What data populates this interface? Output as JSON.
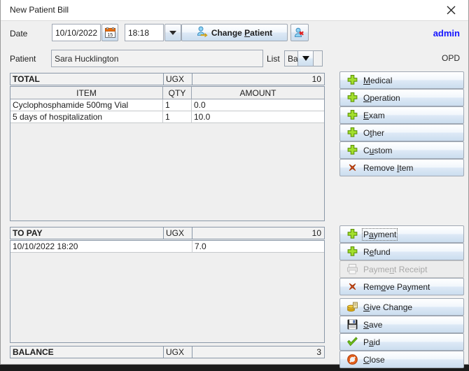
{
  "window": {
    "title": "New Patient Bill",
    "close_icon": "close-icon"
  },
  "header": {
    "date_label": "Date",
    "date_value": "10/10/2022",
    "calendar_icon": "calendar-icon",
    "time_value": "18:18",
    "time_spinner_icon": "chevron-down-icon",
    "change_patient_label_pre": "Change ",
    "change_patient_mnemonic": "P",
    "change_patient_label_post": "atient",
    "change_patient_icon": "user-switch-icon",
    "remove_patient_icon": "user-remove-icon",
    "user": "admin",
    "patient_label": "Patient",
    "patient_value": "Sara Hucklington",
    "list_label": "List",
    "list_value": "Basic",
    "list_arrow_icon": "chevron-down-icon",
    "department": "OPD"
  },
  "items": {
    "total": {
      "label": "TOTAL",
      "currency": "UGX",
      "value": "10"
    },
    "columns": {
      "item": "ITEM",
      "qty": "QTY",
      "amount": "AMOUNT"
    },
    "rows": [
      {
        "item": "Cyclophosphamide 500mg Vial",
        "qty": "1",
        "amount": "0.0"
      },
      {
        "item": "5 days of hospitalization",
        "qty": "1",
        "amount": "10.0"
      }
    ]
  },
  "payments": {
    "to_pay": {
      "label": "TO PAY",
      "currency": "UGX",
      "value": "10"
    },
    "rows": [
      {
        "date": "10/10/2022 18:20",
        "amount": "7.0"
      }
    ],
    "balance": {
      "label": "BALANCE",
      "currency": "UGX",
      "value": "3"
    }
  },
  "item_buttons": [
    {
      "name": "medical",
      "icon": "plus-green-icon",
      "pre": "",
      "mn": "M",
      "post": "edical",
      "disabled": false,
      "focused": false
    },
    {
      "name": "operation",
      "icon": "plus-green-icon",
      "pre": "",
      "mn": "O",
      "post": "peration",
      "disabled": false,
      "focused": false
    },
    {
      "name": "exam",
      "icon": "plus-green-icon",
      "pre": "",
      "mn": "E",
      "post": "xam",
      "disabled": false,
      "focused": false
    },
    {
      "name": "other",
      "icon": "plus-green-icon",
      "pre": "O",
      "mn": "t",
      "post": "her",
      "disabled": false,
      "focused": false
    },
    {
      "name": "custom",
      "icon": "plus-green-icon",
      "pre": "C",
      "mn": "u",
      "post": "stom",
      "disabled": false,
      "focused": false
    },
    {
      "name": "remove-item",
      "icon": "remove-red-icon",
      "pre": "Remove ",
      "mn": "I",
      "post": "tem",
      "disabled": false,
      "focused": false
    }
  ],
  "payment_buttons": [
    {
      "name": "payment",
      "icon": "plus-green-icon",
      "pre": "P",
      "mn": "a",
      "post": "yment",
      "disabled": false,
      "focused": true
    },
    {
      "name": "refund",
      "icon": "plus-green-icon",
      "pre": "R",
      "mn": "e",
      "post": "fund",
      "disabled": false,
      "focused": false
    },
    {
      "name": "payment-receipt",
      "icon": "printer-icon",
      "pre": "Payme",
      "mn": "n",
      "post": "t Receipt",
      "disabled": true,
      "focused": false
    },
    {
      "name": "remove-payment",
      "icon": "remove-red-icon",
      "pre": "Rem",
      "mn": "o",
      "post": "ve Payment",
      "disabled": false,
      "focused": false
    }
  ],
  "action_buttons": [
    {
      "name": "give-change",
      "icon": "coins-icon",
      "pre": "",
      "mn": "G",
      "post": "ive Change",
      "disabled": false,
      "focused": false
    },
    {
      "name": "save",
      "icon": "save-icon",
      "pre": "",
      "mn": "S",
      "post": "ave",
      "disabled": false,
      "focused": false
    },
    {
      "name": "paid",
      "icon": "check-icon",
      "pre": "P",
      "mn": "a",
      "post": "id",
      "disabled": false,
      "focused": false
    },
    {
      "name": "close",
      "icon": "cancel-icon",
      "pre": "",
      "mn": "C",
      "post": "lose",
      "disabled": false,
      "focused": false
    }
  ],
  "colors": {
    "accent_user": "#1414ff",
    "plus_green": "#7ac70c",
    "remove_red": "#d9481b",
    "save_blue": "#2b4f8e",
    "paid_green": "#5cb811",
    "cancel_orange": "#e2611c",
    "panel_bg": "#f0f0f0"
  }
}
